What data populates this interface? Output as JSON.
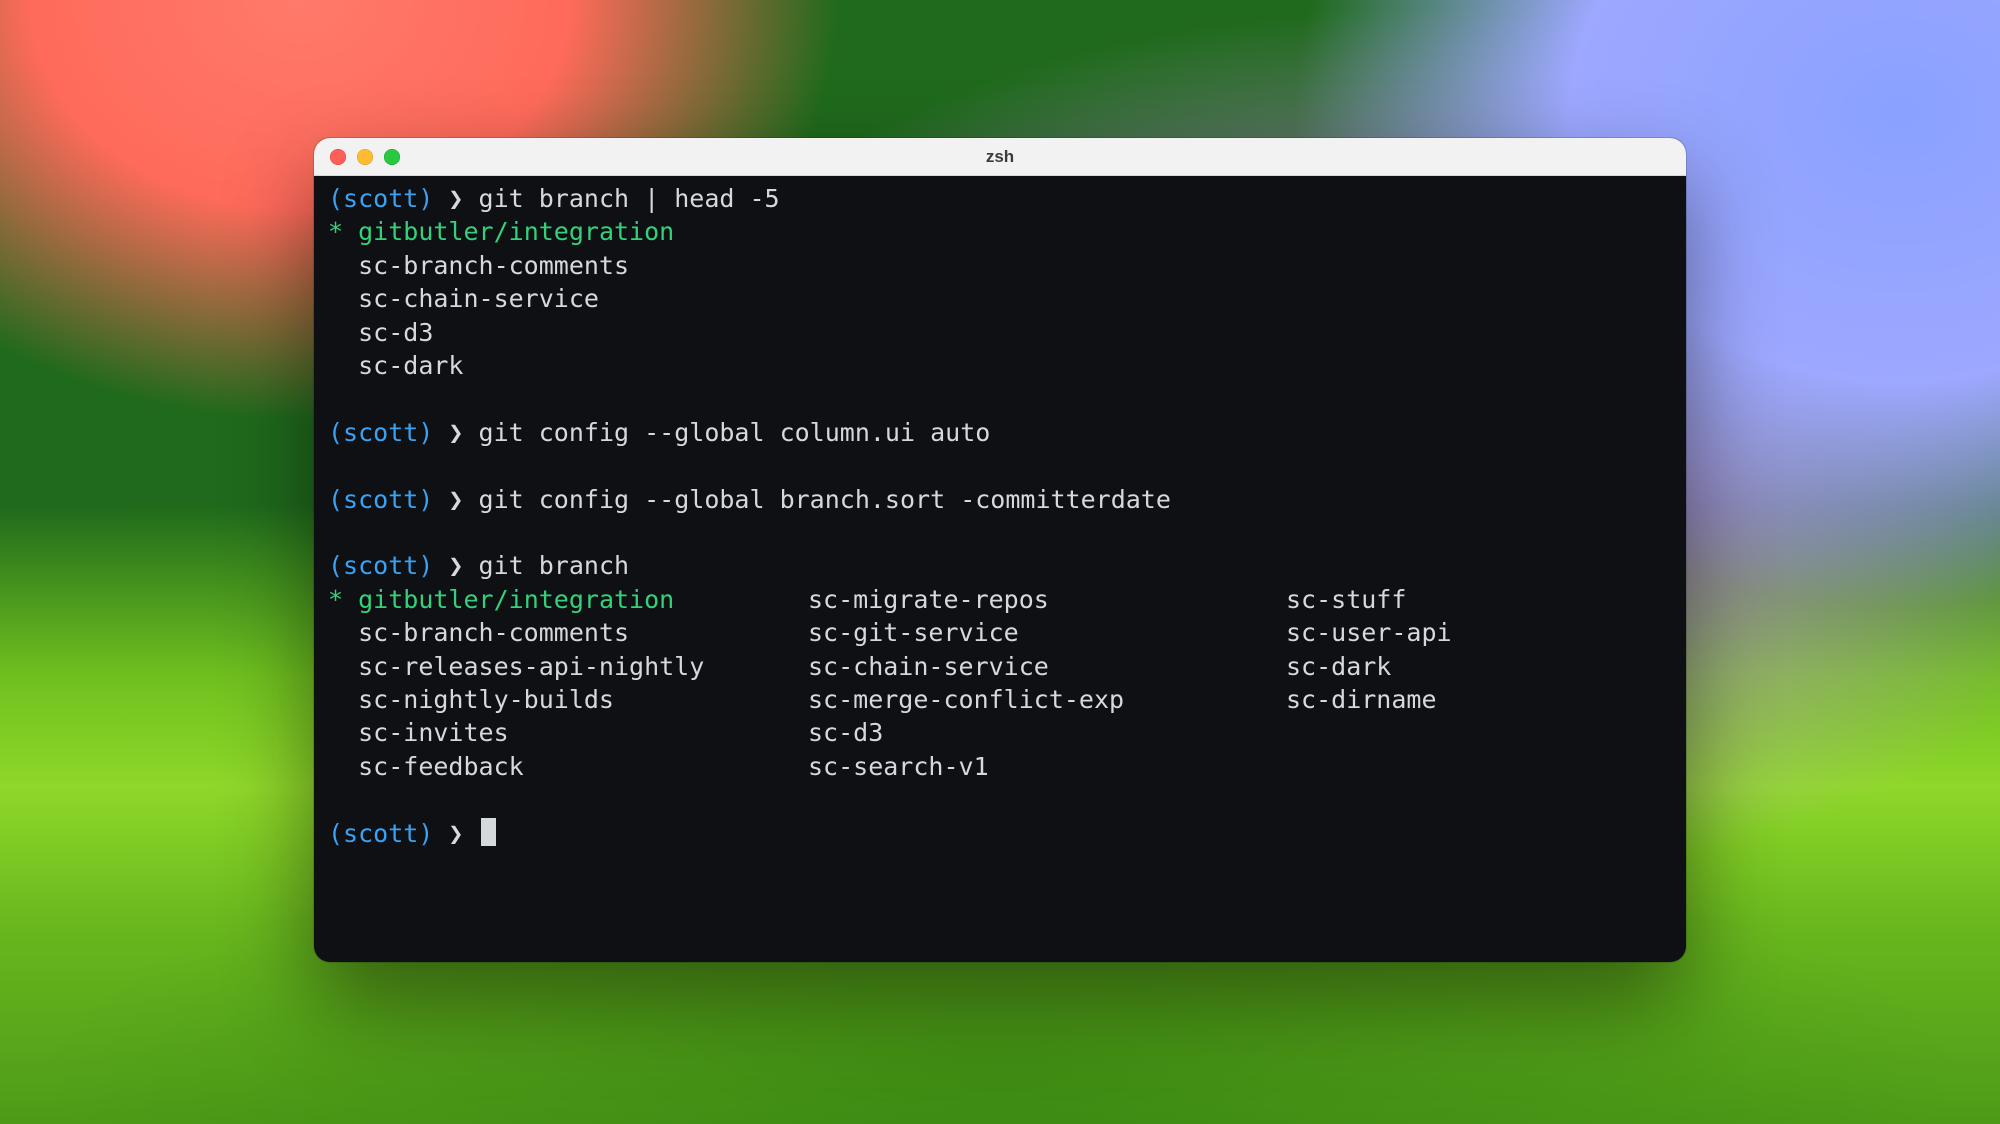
{
  "window": {
    "title": "zsh"
  },
  "prompt": {
    "user": "(scott)",
    "arrow": "❯"
  },
  "blocks": [
    {
      "cmd": "git branch | head -5",
      "output_lines": [
        {
          "star": "*",
          "text": "gitbutler/integration",
          "active": true
        },
        {
          "star": " ",
          "text": "sc-branch-comments"
        },
        {
          "star": " ",
          "text": "sc-chain-service"
        },
        {
          "star": " ",
          "text": "sc-d3"
        },
        {
          "star": " ",
          "text": "sc-dark"
        }
      ]
    },
    {
      "cmd": "git config --global column.ui auto"
    },
    {
      "cmd": "git config --global branch.sort -committerdate"
    },
    {
      "cmd": "git branch",
      "columns": {
        "col1": [
          {
            "star": "*",
            "text": "gitbutler/integration",
            "active": true
          },
          {
            "star": " ",
            "text": "sc-branch-comments"
          },
          {
            "star": " ",
            "text": "sc-releases-api-nightly"
          },
          {
            "star": " ",
            "text": "sc-nightly-builds"
          },
          {
            "star": " ",
            "text": "sc-invites"
          },
          {
            "star": " ",
            "text": "sc-feedback"
          }
        ],
        "col2": [
          "sc-migrate-repos",
          "sc-git-service",
          "sc-chain-service",
          "sc-merge-conflict-exp",
          "sc-d3",
          "sc-search-v1"
        ],
        "col3": [
          "sc-stuff",
          "sc-user-api",
          "sc-dark",
          "sc-dirname"
        ]
      }
    }
  ]
}
